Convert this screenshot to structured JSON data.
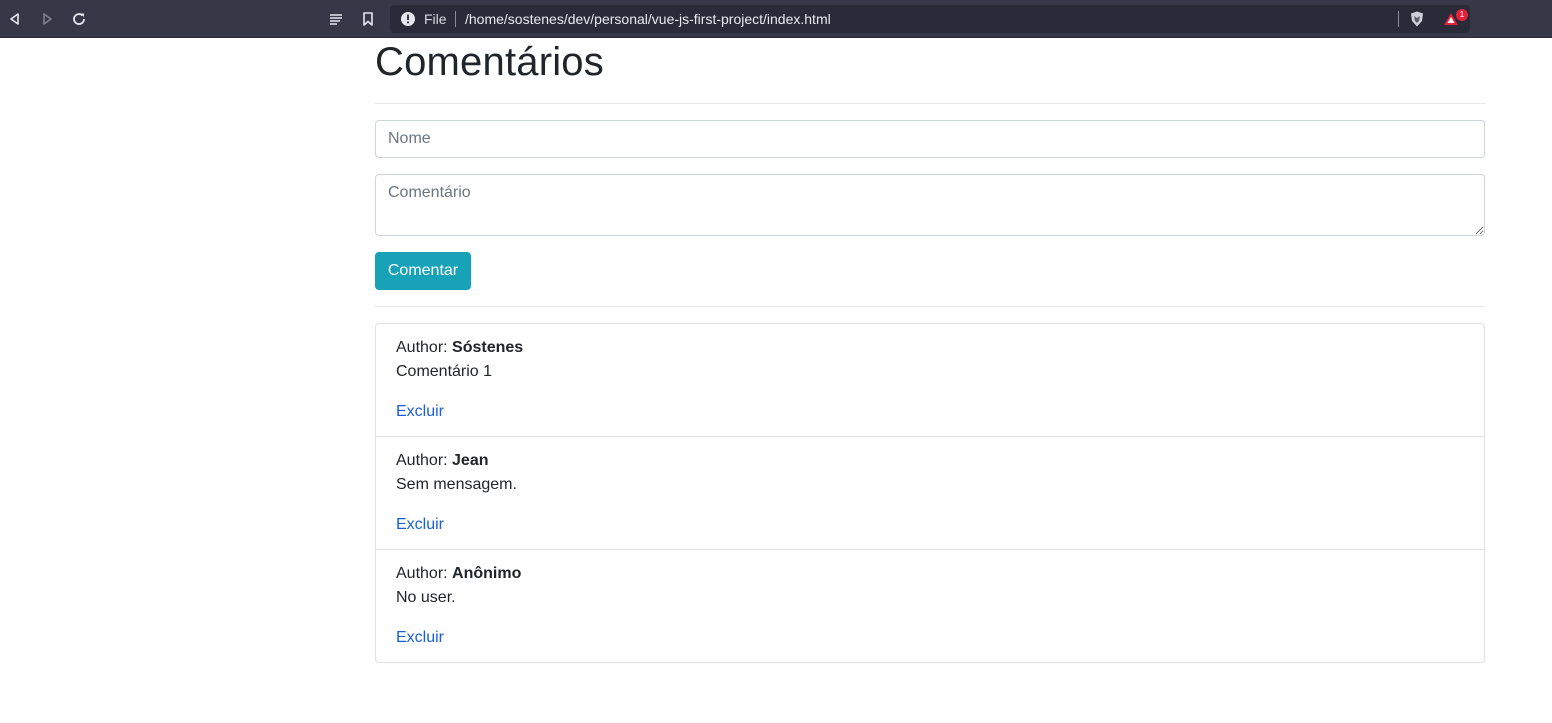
{
  "browser": {
    "url_scheme_label": "File",
    "url": "/home/sostenes/dev/personal/vue-js-first-project/index.html",
    "notification_count": "1",
    "toolbar_color": "#363848",
    "icons": [
      "back-icon",
      "forward-icon",
      "reload-icon",
      "reader-mode-icon",
      "bookmark-icon",
      "info-icon",
      "brave-shields-icon",
      "brave-rewards-icon"
    ]
  },
  "page": {
    "title": "Comentários",
    "form": {
      "name_placeholder": "Nome",
      "comment_placeholder": "Comentário",
      "submit_label": "Comentar",
      "submit_color": "#17a2b8"
    },
    "comments": [
      {
        "author_prefix": "Author: ",
        "author": "Sóstenes",
        "message": "Comentário 1",
        "delete_label": "Excluir"
      },
      {
        "author_prefix": "Author: ",
        "author": "Jean",
        "message": "Sem mensagem.",
        "delete_label": "Excluir"
      },
      {
        "author_prefix": "Author: ",
        "author": "Anônimo",
        "message": "No user.",
        "delete_label": "Excluir"
      }
    ],
    "link_color": "#1a5fd6"
  }
}
